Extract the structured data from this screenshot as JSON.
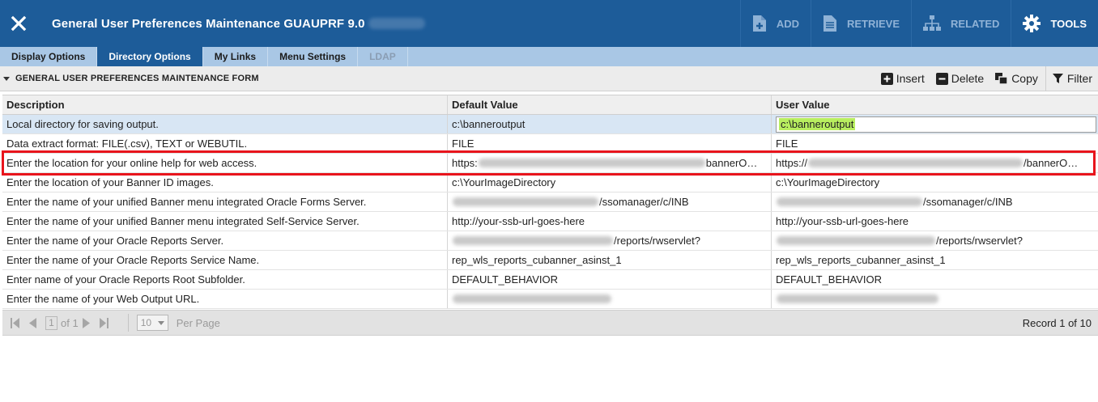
{
  "header": {
    "title": "General User Preferences Maintenance GUAUPRF 9.0",
    "add_label": "ADD",
    "retrieve_label": "RETRIEVE",
    "related_label": "RELATED",
    "tools_label": "TOOLS"
  },
  "tabs": [
    {
      "label": "Display Options",
      "state": "normal"
    },
    {
      "label": "Directory Options",
      "state": "active"
    },
    {
      "label": "My Links",
      "state": "normal"
    },
    {
      "label": "Menu Settings",
      "state": "normal"
    },
    {
      "label": "LDAP",
      "state": "disabled"
    }
  ],
  "section": {
    "title": "GENERAL USER PREFERENCES MAINTENANCE FORM",
    "insert_label": "Insert",
    "delete_label": "Delete",
    "copy_label": "Copy",
    "filter_label": "Filter"
  },
  "grid": {
    "headers": {
      "description": "Description",
      "default_value": "Default Value",
      "user_value": "User Value"
    },
    "rows": [
      {
        "description": "Local directory for saving output.",
        "default_value": "c:\\banneroutput",
        "user_value": "c:\\banneroutput"
      },
      {
        "description": "Data extract format: FILE(.csv), TEXT or WEBUTIL.",
        "default_value": "FILE",
        "user_value": "FILE"
      },
      {
        "description": "Enter the location for your online help for web access.",
        "default_prefix": "https:",
        "default_suffix": "bannerO…",
        "user_prefix": "https://",
        "user_suffix": "/bannerO…"
      },
      {
        "description": "Enter the location of your Banner ID images.",
        "default_value": "c:\\YourImageDirectory",
        "user_value": "c:\\YourImageDirectory"
      },
      {
        "description": "Enter the name of your unified Banner menu integrated Oracle Forms Server.",
        "default_suffix": "/ssomanager/c/INB",
        "user_suffix": "/ssomanager/c/INB"
      },
      {
        "description": "Enter the name of your unified Banner menu integrated Self-Service Server.",
        "default_value": "http://your-ssb-url-goes-here",
        "user_value": "http://your-ssb-url-goes-here"
      },
      {
        "description": "Enter the name of your Oracle Reports Server.",
        "default_suffix": "/reports/rwservlet?",
        "user_suffix": "/reports/rwservlet?"
      },
      {
        "description": "Enter the name of your Oracle Reports Service Name.",
        "default_value": "rep_wls_reports_cubanner_asinst_1",
        "user_value": "rep_wls_reports_cubanner_asinst_1"
      },
      {
        "description": "Enter name of your Oracle Reports Root Subfolder.",
        "default_value": "DEFAULT_BEHAVIOR",
        "user_value": "DEFAULT_BEHAVIOR"
      },
      {
        "description": "Enter the name of your Web Output URL."
      }
    ]
  },
  "pager": {
    "page": "1",
    "of_label": "of 1",
    "per_page_value": "10",
    "per_page_label": "Per Page",
    "record_label": "Record 1 of 10"
  }
}
